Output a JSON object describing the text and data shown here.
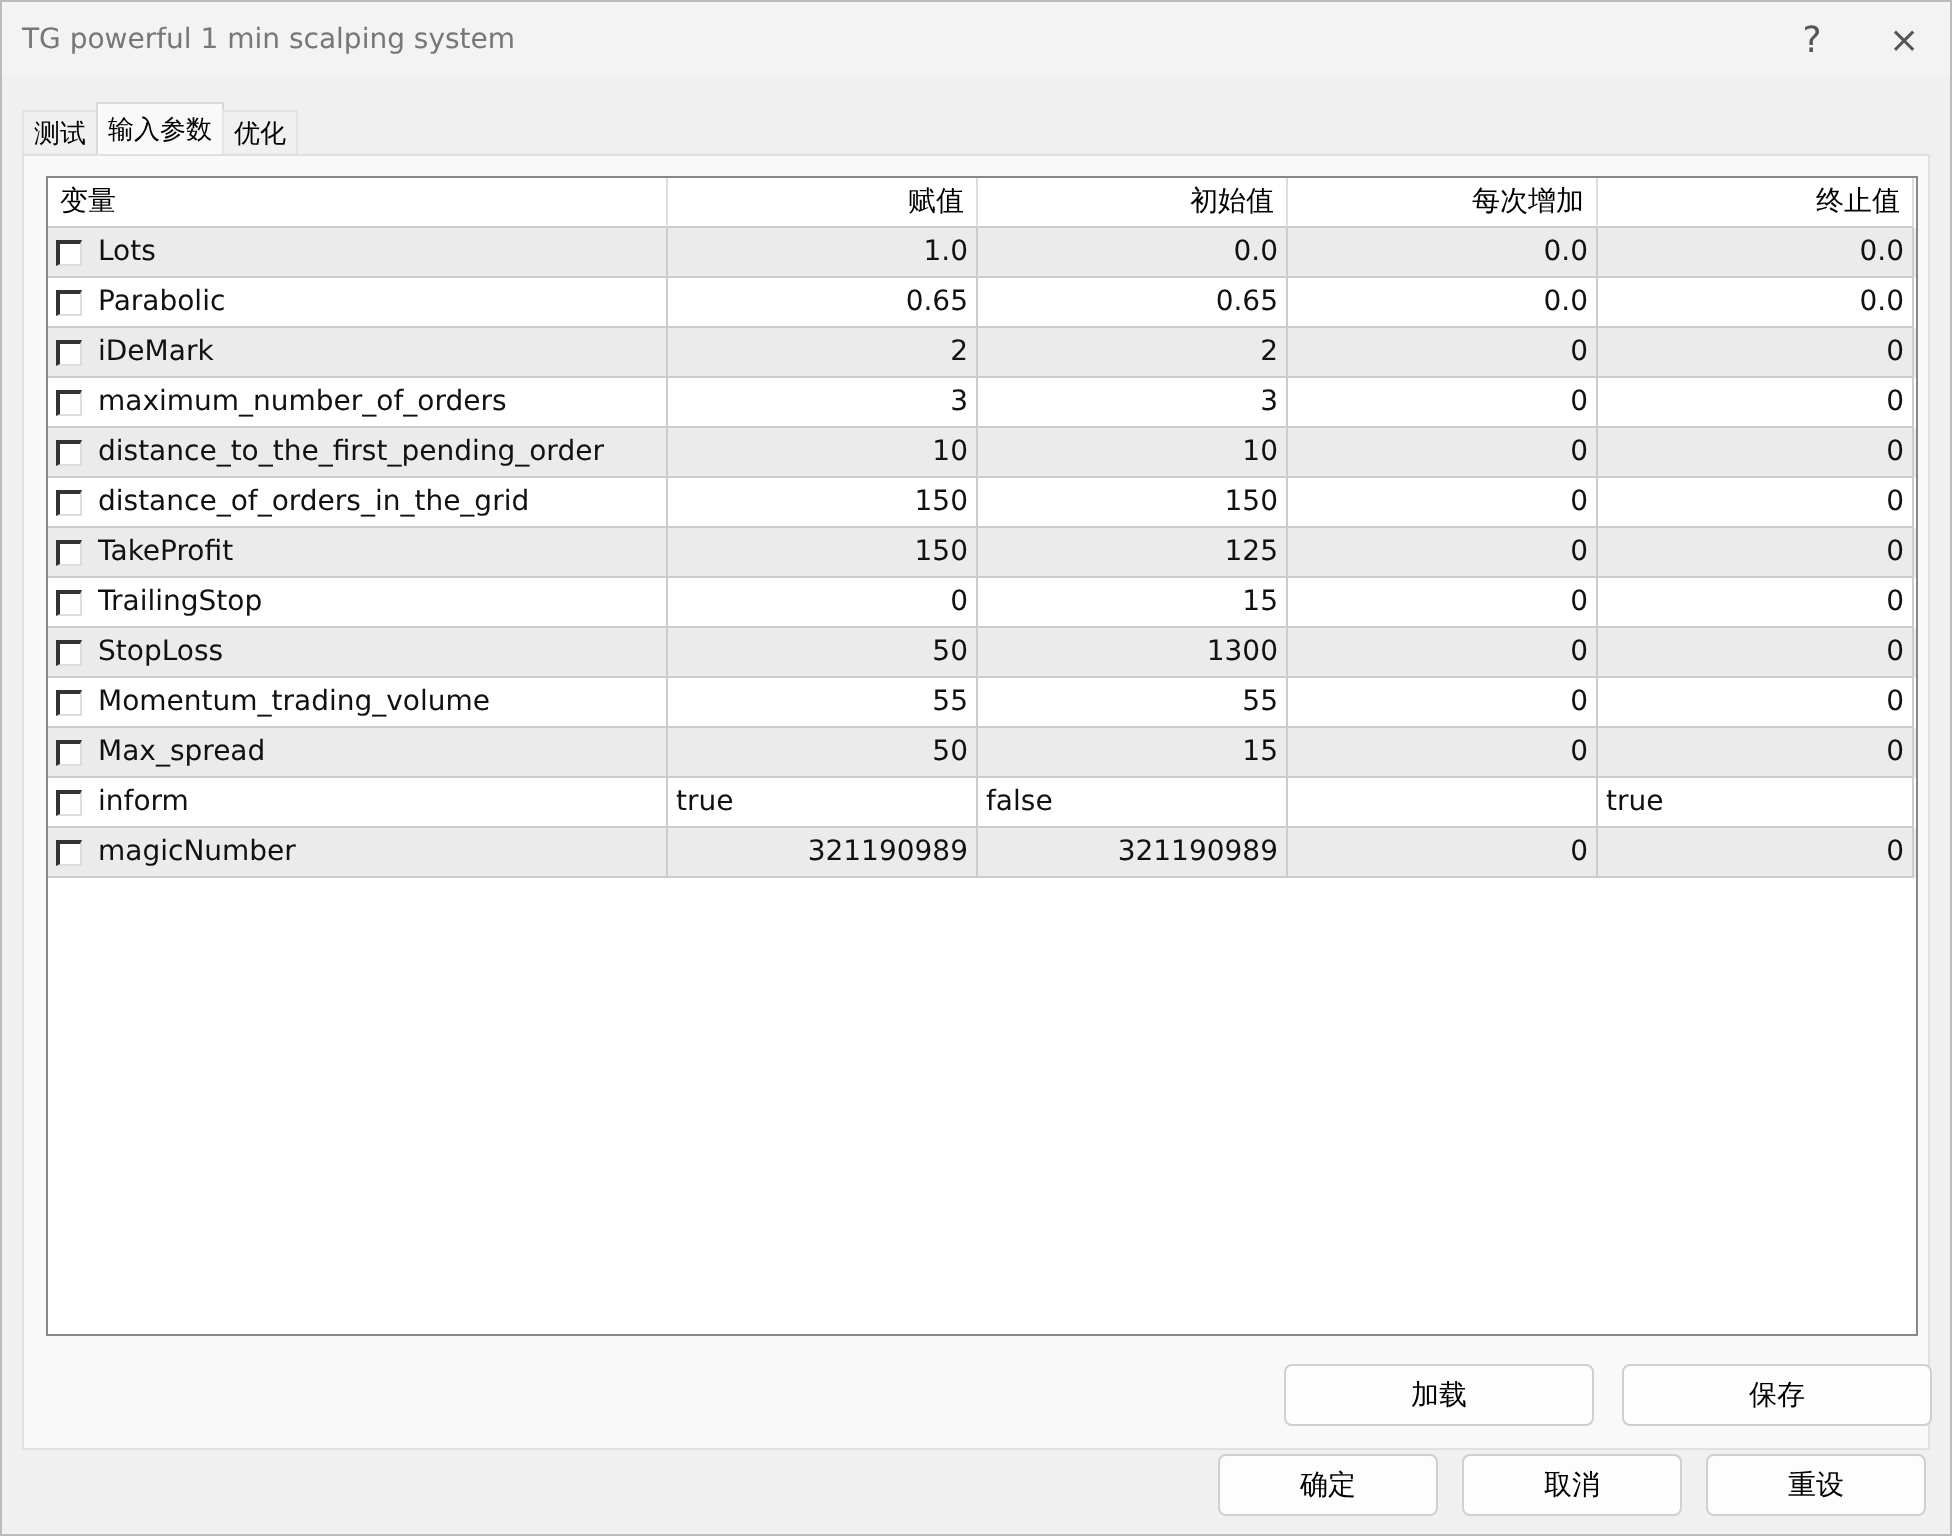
{
  "window": {
    "title": "TG powerful 1 min scalping system",
    "help": "?",
    "close": "×"
  },
  "tabs": [
    {
      "label": "测试",
      "selected": false
    },
    {
      "label": "输入参数",
      "selected": true
    },
    {
      "label": "优化",
      "selected": false
    }
  ],
  "table": {
    "columns": [
      "变量",
      "赋值",
      "初始值",
      "每次增加",
      "终止值"
    ],
    "rows": [
      {
        "kind": "number",
        "checked": false,
        "cells": [
          "Lots",
          "1.0",
          "0.0",
          "0.0",
          "0.0"
        ]
      },
      {
        "kind": "number",
        "checked": false,
        "cells": [
          "Parabolic",
          "0.65",
          "0.65",
          "0.0",
          "0.0"
        ]
      },
      {
        "kind": "number",
        "checked": false,
        "cells": [
          "iDeMark",
          "2",
          "2",
          "0",
          "0"
        ]
      },
      {
        "kind": "number",
        "checked": false,
        "cells": [
          "maximum_number_of_orders",
          "3",
          "3",
          "0",
          "0"
        ]
      },
      {
        "kind": "number",
        "checked": false,
        "cells": [
          "distance_to_the_first_pending_order",
          "10",
          "10",
          "0",
          "0"
        ]
      },
      {
        "kind": "number",
        "checked": false,
        "cells": [
          "distance_of_orders_in_the_grid",
          "150",
          "150",
          "0",
          "0"
        ]
      },
      {
        "kind": "number",
        "checked": false,
        "cells": [
          "TakeProfit",
          "150",
          "125",
          "0",
          "0"
        ]
      },
      {
        "kind": "number",
        "checked": false,
        "cells": [
          "TrailingStop",
          "0",
          "15",
          "0",
          "0"
        ]
      },
      {
        "kind": "number",
        "checked": false,
        "cells": [
          "StopLoss",
          "50",
          "1300",
          "0",
          "0"
        ]
      },
      {
        "kind": "number",
        "checked": false,
        "cells": [
          "Momentum_trading_volume",
          "55",
          "55",
          "0",
          "0"
        ]
      },
      {
        "kind": "number",
        "checked": false,
        "cells": [
          "Max_spread",
          "50",
          "15",
          "0",
          "0"
        ]
      },
      {
        "kind": "bool",
        "checked": false,
        "cells": [
          "inform",
          "true",
          "false",
          "",
          "true"
        ]
      },
      {
        "kind": "number",
        "checked": false,
        "cells": [
          "magicNumber",
          "321190989",
          "321190989",
          "0",
          "0"
        ]
      }
    ]
  },
  "panel_buttons": [
    "加载",
    "保存"
  ],
  "dialog_buttons": [
    "确定",
    "取消",
    "重设"
  ]
}
